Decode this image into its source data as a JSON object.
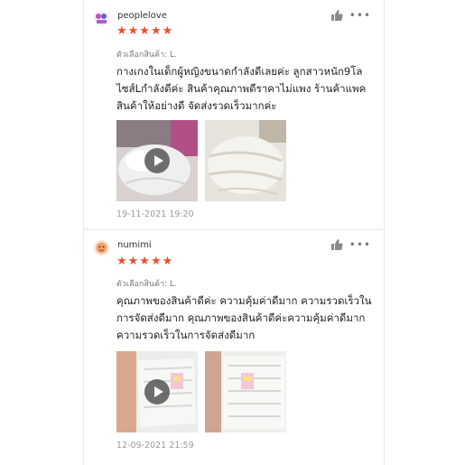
{
  "reviews": [
    {
      "username": "peoplelove",
      "rating": 5,
      "stars": "★★★★★",
      "variant_label": "ตัวเลือกสินค้า: L.",
      "text": "กางเกงในเด็กผู้หญิงขนาดกำลังดีเลยค่ะ ลูกสาวหนัก9โลไซส์Lกำลังดีค่ะ สินค้าคุณภาพดีราคาไม่แพง ร้านค้าแพคสินค้าให้อย่างดี จัดส่งรวดเร็วมากค่ะ",
      "date": "19-11-2021 19:20",
      "media": [
        {
          "type": "video",
          "icon": "play-icon"
        },
        {
          "type": "image"
        }
      ]
    },
    {
      "username": "numimi",
      "rating": 5,
      "stars": "★★★★★",
      "variant_label": "ตัวเลือกสินค้า: L.",
      "text": "คุณภาพของสินค้าดีค่ะ ความคุ้มค่าดีมาก ความรวดเร็วในการจัดส่งดีมาก คุณภาพของสินค้าดีค่ะความคุ้มค่าดีมาก ความรวดเร็วในการจัดส่งดีมาก",
      "date": "12-09-2021 21:59",
      "media": [
        {
          "type": "video",
          "icon": "play-icon"
        },
        {
          "type": "image"
        }
      ]
    }
  ],
  "icons": {
    "like": "thumbs-up-icon",
    "more": "more-dots-icon"
  },
  "colors": {
    "star": "#ee4d2d",
    "username": "#333333",
    "date": "#9a9a9a"
  }
}
